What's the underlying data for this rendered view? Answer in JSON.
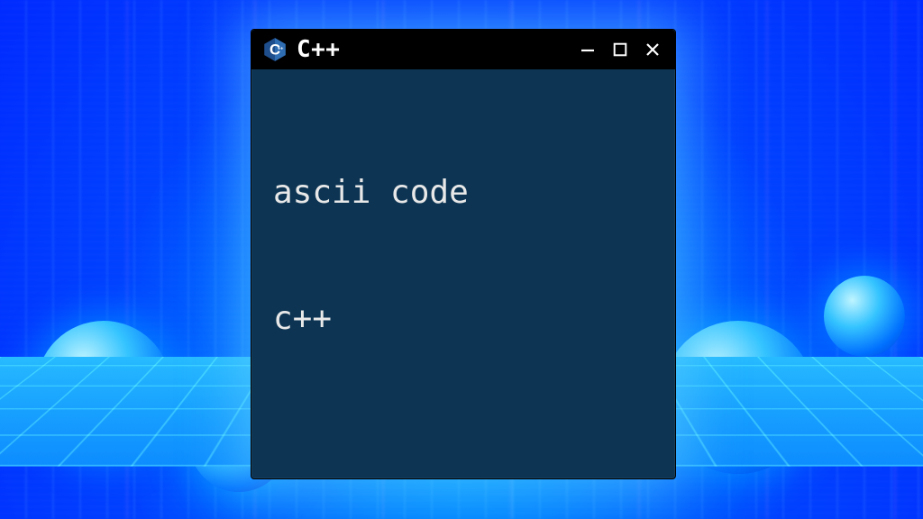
{
  "window": {
    "title": "C++",
    "icon": "cpp-logo",
    "body_lines": [
      "ascii code",
      "c++"
    ]
  },
  "colors": {
    "titlebar_bg": "#000000",
    "window_bg": "#0d3553",
    "text": "#e8e8e8",
    "glow": "#64d2ff"
  }
}
